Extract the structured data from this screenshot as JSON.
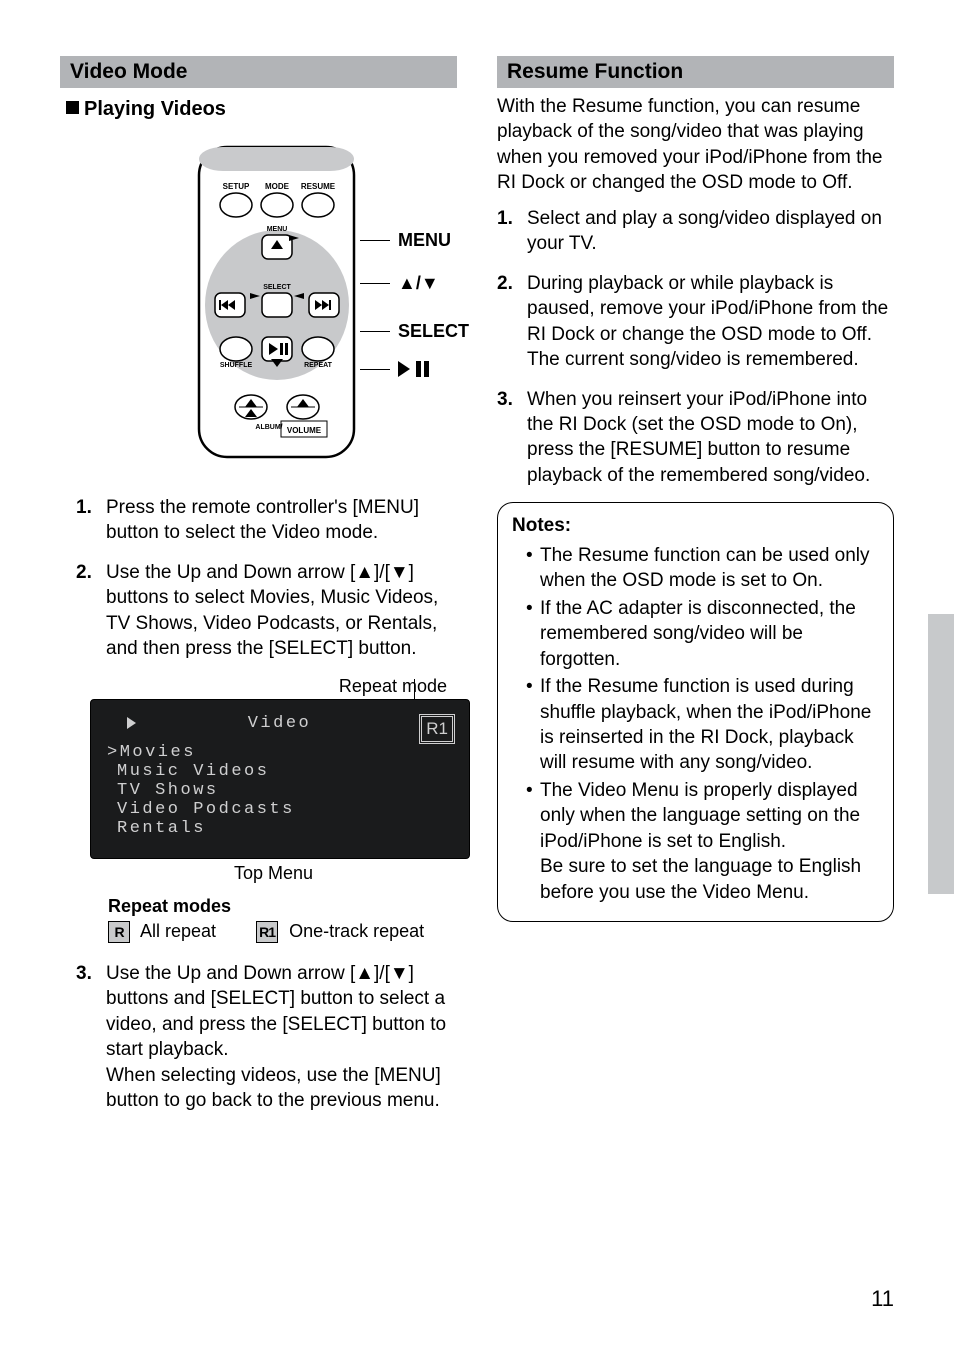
{
  "pageNumber": "11",
  "left": {
    "heading": "Video Mode",
    "subhead": "Playing Videos",
    "remote_labels": [
      "SETUP",
      "MODE",
      "RESUME",
      "MENU",
      "SELECT",
      "SHUFFLE",
      "REPEAT",
      "ALBUM/",
      "VOLUME"
    ],
    "callouts": {
      "menu": "MENU",
      "arrows": "▲/▼",
      "select": "SELECT",
      "playpause": "▶ ▌▌"
    },
    "steps": [
      {
        "num": "1.",
        "text": "Press the remote controller's [MENU] button to select the Video mode."
      },
      {
        "num": "2.",
        "text": "Use the Up and Down arrow [▲]/[▼] buttons to select Movies, Music Videos, TV Shows, Video Podcasts, or Rentals, and then press the [SELECT] button."
      }
    ],
    "repeat_mode_label": "Repeat mode",
    "tv": {
      "title": "Video",
      "r1": "R1",
      "items": [
        "Movies",
        "Music Videos",
        "TV Shows",
        "Video Podcasts",
        "Rentals"
      ]
    },
    "top_menu_label": "Top Menu",
    "repeat_modes_title": "Repeat modes",
    "repeat_modes": {
      "r": "R",
      "r1": "R1",
      "all": "All repeat",
      "one": "One-track repeat"
    },
    "steps2": [
      {
        "num": "3.",
        "text": "Use the Up and Down arrow [▲]/[▼] buttons and [SELECT] button to select a video, and press the [SELECT] button to start playback.\nWhen selecting videos, use the [MENU] button to go back to the previous menu."
      }
    ]
  },
  "right": {
    "heading": "Resume Function",
    "intro": "With the Resume function, you can resume playback of the song/video that was playing when you removed your iPod/iPhone from the RI Dock or changed the OSD mode to Off.",
    "steps": [
      {
        "num": "1.",
        "text": "Select and play a song/video displayed on your TV."
      },
      {
        "num": "2.",
        "text": "During playback or while playback is paused, remove your iPod/iPhone from the RI Dock or change the OSD mode to Off. The current song/video is remembered."
      },
      {
        "num": "3.",
        "text": "When you reinsert your iPod/iPhone into the RI Dock (set the OSD mode to On), press the [RESUME] button to resume playback of the remembered song/video."
      }
    ],
    "notes_title": "Notes:",
    "notes": [
      "The Resume function can be used only when the OSD mode is set to On.",
      "If the AC adapter is disconnected, the remembered song/video will be forgotten.",
      "If the Resume function is used during shuffle playback, when the iPod/iPhone is reinserted in the RI Dock, playback will resume with any song/video.",
      "The Video Menu is properly displayed only when the language setting on the iPod/iPhone is set to English.\nBe sure to set the language to English before you use the Video Menu."
    ]
  }
}
